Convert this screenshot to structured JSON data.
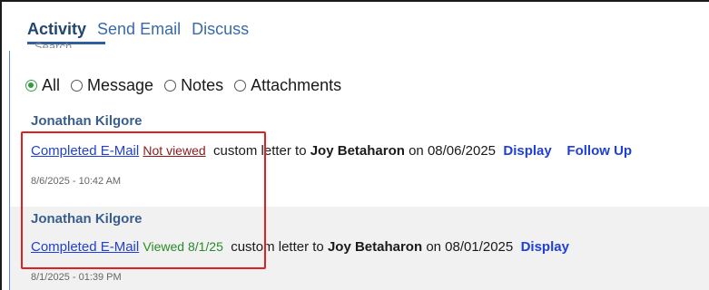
{
  "tabs": [
    {
      "label": "Activity",
      "active": true
    },
    {
      "label": "Send Email",
      "active": false
    },
    {
      "label": "Discuss",
      "active": false
    }
  ],
  "ghost_text": "Search",
  "filters": {
    "selected": "All",
    "options": [
      "All",
      "Message",
      "Notes",
      "Attachments"
    ]
  },
  "entries": [
    {
      "author": "Jonathan Kilgore",
      "link": "Completed E-Mail",
      "status": "Not viewed",
      "text_before": "custom letter to",
      "recipient": "Joy Betaharon",
      "text_on": "on 08/06/2025",
      "actions": [
        "Display",
        "Follow Up"
      ],
      "timestamp": "8/6/2025 - 10:42 AM"
    },
    {
      "author": "Jonathan Kilgore",
      "link": "Completed E-Mail",
      "status": "Viewed 8/1/25",
      "text_before": "custom letter to",
      "recipient": "Joy Betaharon",
      "text_on": "on 08/01/2025",
      "actions": [
        "Display"
      ],
      "timestamp": "8/1/2025 - 01:39 PM"
    }
  ],
  "colors": {
    "tab_active": "#22466f",
    "tab": "#3a6aa6",
    "author": "#3a5e8c",
    "link": "#1f3fd8",
    "not_viewed": "#8b1a1a",
    "viewed": "#2a8a2a",
    "highlight": "#e02020",
    "alt_row": "#f1f1f1"
  }
}
